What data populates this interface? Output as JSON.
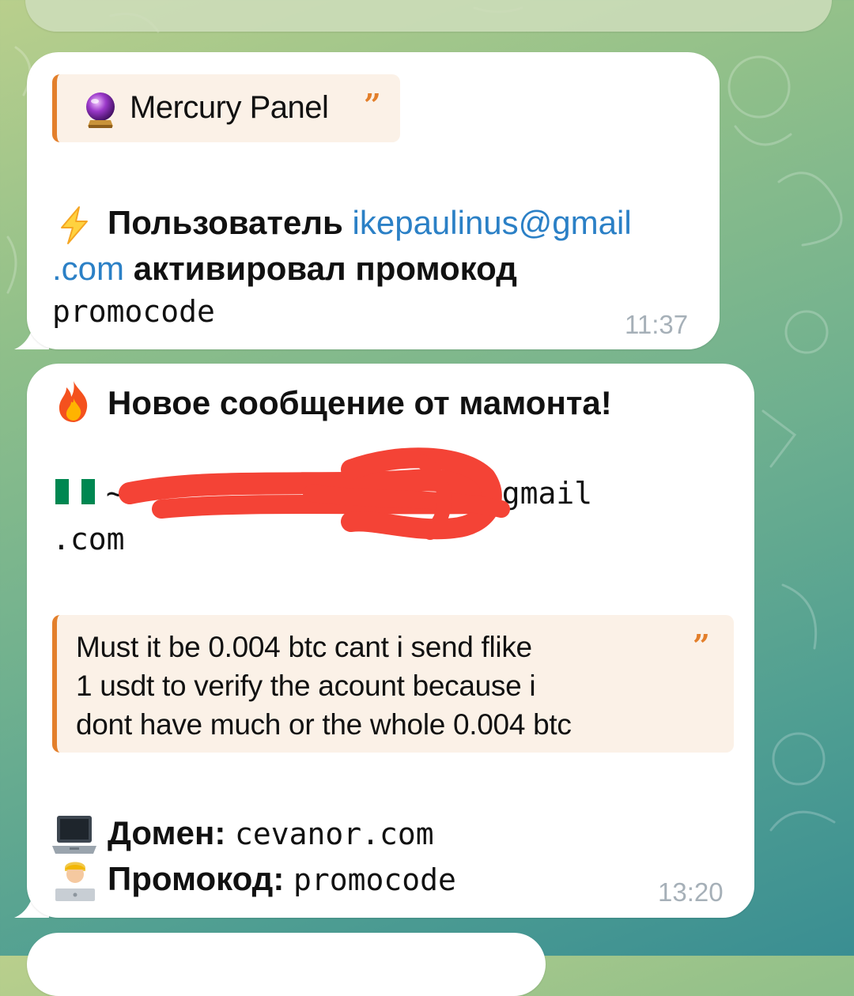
{
  "messages": [
    {
      "quote_title": "Mercury Panel",
      "line1_prefix": "Пользователь",
      "email_part1": "ikepaulinus@gmail",
      "email_part2": ".com",
      "line2_suffix": "активировал промокод",
      "promocode": "promocode",
      "time": "11:37"
    },
    {
      "title": "Новое сообщение от мамонта!",
      "email_visible_start": "~",
      "email_visible_end": "7@gmail",
      "email_line2": ".com",
      "quote_lines": [
        "Must it be 0.004 btc cant i send flike",
        "1 usdt to verify the acount because i",
        "dont have much or the whole 0.004 btc"
      ],
      "domain_label": "Домен:",
      "domain_value": "cevanor.com",
      "promo_label": "Промокод:",
      "promo_value": "promocode",
      "time": "13:20"
    }
  ],
  "icons": [
    "crystal-ball-icon",
    "lightning-icon",
    "fire-icon",
    "nigeria-flag-icon",
    "laptop-icon",
    "technologist-icon",
    "quote-icon"
  ],
  "colors": {
    "accent": "#e37f2b",
    "link": "#2b80c6",
    "quote_bg": "#fbf1e7",
    "time": "#a6b0b8",
    "redaction": "#f44336"
  }
}
